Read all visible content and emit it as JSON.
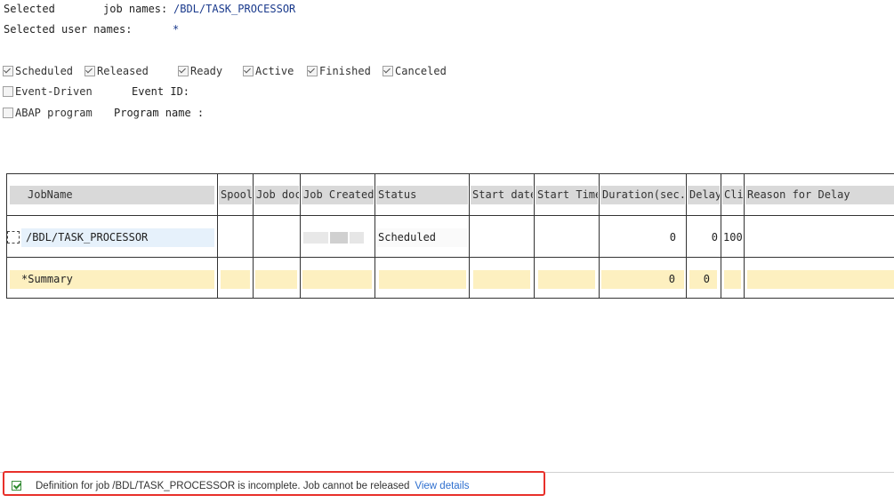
{
  "selection": {
    "job_label_1": "Selected",
    "job_label_2": "job names:",
    "job_value": "/BDL/TASK_PROCESSOR",
    "user_label": "Selected user names:",
    "user_value": "*"
  },
  "status_filters": [
    {
      "label": "Scheduled",
      "checked": true
    },
    {
      "label": "Released",
      "checked": true
    },
    {
      "label": "Ready",
      "checked": true
    },
    {
      "label": "Active",
      "checked": true
    },
    {
      "label": "Finished",
      "checked": true
    },
    {
      "label": "Canceled",
      "checked": true
    }
  ],
  "event_driven": {
    "label": "Event-Driven",
    "checked": false,
    "event_id_label": "Event ID:"
  },
  "abap_program": {
    "label": "ABAP program",
    "checked": false,
    "program_name_label": "Program name :"
  },
  "table": {
    "columns": [
      "JobName",
      "Spool",
      "Job doc",
      "Job CreatedB",
      "Status",
      "Start date",
      "Start Time",
      "Duration(sec.)",
      "Delay",
      "Cli",
      "Reason for Delay"
    ],
    "row": {
      "JobName": "/BDL/TASK_PROCESSOR",
      "Status": "Scheduled",
      "Duration": "0",
      "Delay": "0",
      "Cli": "100"
    },
    "summary": {
      "label": "*Summary",
      "Duration": "0",
      "Delay": "0"
    }
  },
  "message": {
    "text": "Definition for job /BDL/TASK_PROCESSOR is incomplete. Job cannot be released",
    "link": "View details",
    "status_color": "#2e8b2e",
    "highlight_color": "#e8302a"
  }
}
